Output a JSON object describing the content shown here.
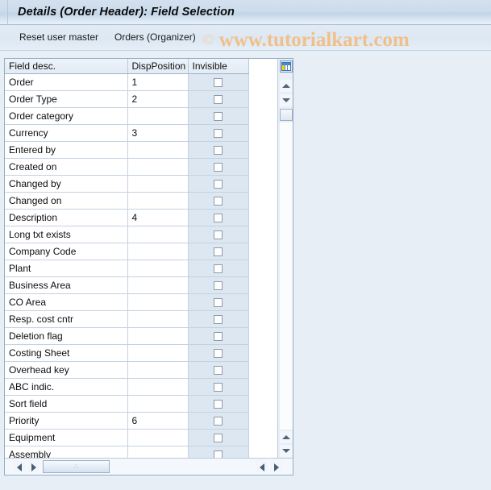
{
  "window": {
    "title": "Details (Order Header): Field Selection"
  },
  "toolbar": {
    "reset_label": "Reset user master",
    "orders_label": "Orders (Organizer)"
  },
  "watermark": {
    "copyright": "©",
    "text": "www.tutorialkart.com",
    "color": "#f0c08a"
  },
  "table": {
    "config_icon": "table-settings-icon",
    "columns": [
      "Field desc.",
      "DispPosition",
      "Invisible"
    ],
    "rows": [
      {
        "field": "Order",
        "disp": "1",
        "invisible": false
      },
      {
        "field": "Order Type",
        "disp": "2",
        "invisible": false
      },
      {
        "field": "Order category",
        "disp": "",
        "invisible": false
      },
      {
        "field": "Currency",
        "disp": "3",
        "invisible": false
      },
      {
        "field": "Entered by",
        "disp": "",
        "invisible": false
      },
      {
        "field": "Created on",
        "disp": "",
        "invisible": false
      },
      {
        "field": "Changed by",
        "disp": "",
        "invisible": false
      },
      {
        "field": "Changed on",
        "disp": "",
        "invisible": false
      },
      {
        "field": "Description",
        "disp": "4",
        "invisible": false
      },
      {
        "field": "Long txt exists",
        "disp": "",
        "invisible": false
      },
      {
        "field": "Company Code",
        "disp": "",
        "invisible": false
      },
      {
        "field": "Plant",
        "disp": "",
        "invisible": false
      },
      {
        "field": "Business Area",
        "disp": "",
        "invisible": false
      },
      {
        "field": "CO Area",
        "disp": "",
        "invisible": false
      },
      {
        "field": "Resp. cost cntr",
        "disp": "",
        "invisible": false
      },
      {
        "field": "Deletion flag",
        "disp": "",
        "invisible": false
      },
      {
        "field": "Costing Sheet",
        "disp": "",
        "invisible": false
      },
      {
        "field": "Overhead key",
        "disp": "",
        "invisible": false
      },
      {
        "field": "ABC indic.",
        "disp": "",
        "invisible": false
      },
      {
        "field": "Sort field",
        "disp": "",
        "invisible": false
      },
      {
        "field": "Priority",
        "disp": "6",
        "invisible": false
      },
      {
        "field": "Equipment",
        "disp": "",
        "invisible": false
      },
      {
        "field": "Assembly",
        "disp": "",
        "invisible": false
      }
    ]
  },
  "scrollbars": {
    "vertical_up": "scroll-up-icon",
    "vertical_down": "scroll-down-icon",
    "horizontal_left": "scroll-left-icon",
    "horizontal_right": "scroll-right-icon",
    "thumb_grip": "∴"
  }
}
